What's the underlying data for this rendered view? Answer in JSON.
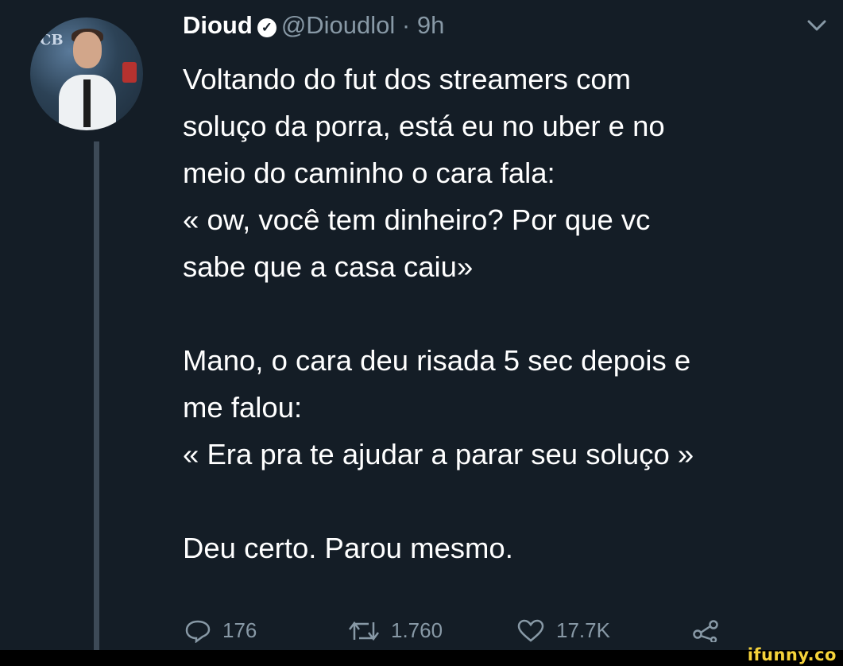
{
  "tweet": {
    "display_name": "Dioud",
    "handle": "@Dioudlol",
    "separator": "·",
    "time": "9h",
    "text": "Voltando do fut dos streamers com\nsoluço da porra, está eu no uber e no\nmeio do caminho o cara fala:\n« ow, você tem dinheiro? Por que vc\nsabe que a casa caiu»\n\nMano, o cara deu risada 5 sec depois e\nme falou:\n« Era pra te ajudar a parar seu soluço »\n\nDeu certo. Parou mesmo.",
    "avatar_badge": "CB"
  },
  "actions": {
    "replies": "176",
    "retweets": "1.760",
    "likes": "17.7K"
  },
  "icons": {
    "verified": "verified-badge-icon",
    "chevron": "chevron-down-icon",
    "reply": "reply-icon",
    "retweet": "retweet-icon",
    "like": "heart-icon",
    "share": "share-icon"
  },
  "watermark": "ifunny.co",
  "colors": {
    "background": "#141d26",
    "text": "#ffffff",
    "muted": "#8899a6",
    "thread_line": "#3d4a57",
    "watermark": "#f5d23a"
  }
}
